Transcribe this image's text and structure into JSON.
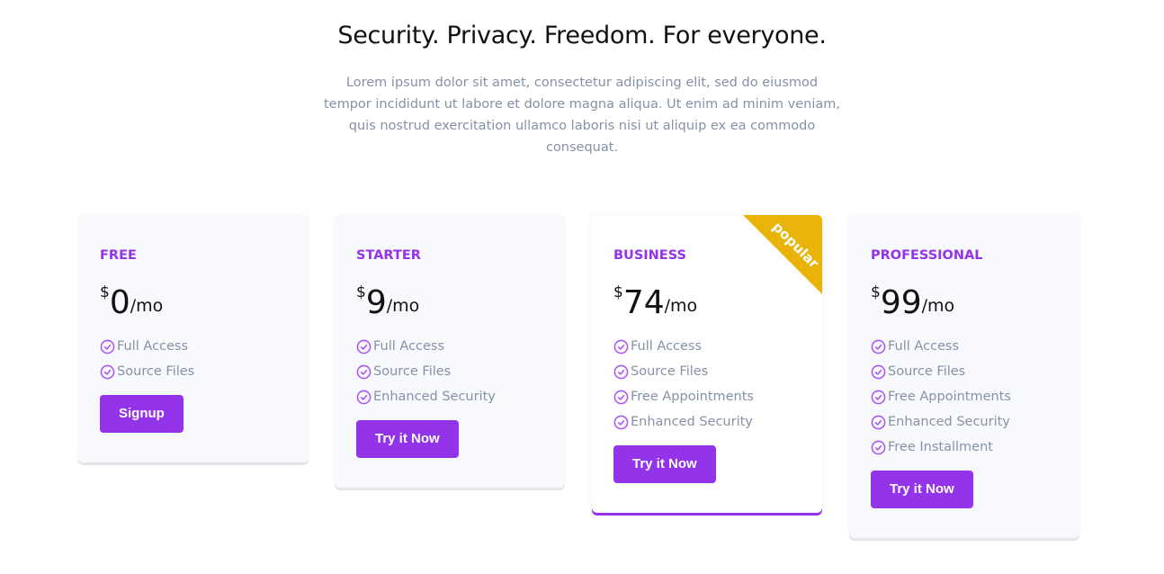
{
  "header": {
    "title": "Security. Privacy. Freedom. For everyone.",
    "description": "Lorem ipsum dolor sit amet, consectetur adipiscing elit, sed do eiusmod tempor incididunt ut labore et dolore magna aliqua. Ut enim ad minim veniam, quis nostrud exercitation ullamco laboris nisi ut aliquip ex ea commodo consequat."
  },
  "colors": {
    "accent": "#9333ea",
    "ribbon": "#eab308",
    "muted": "#8492a6"
  },
  "plans": [
    {
      "name": "FREE",
      "currency": "$",
      "amount": "0",
      "period": "/mo",
      "features": [
        "Full Access",
        "Source Files"
      ],
      "button": "Signup"
    },
    {
      "name": "STARTER",
      "currency": "$",
      "amount": "9",
      "period": "/mo",
      "features": [
        "Full Access",
        "Source Files",
        "Enhanced Security"
      ],
      "button": "Try it Now"
    },
    {
      "name": "BUSINESS",
      "currency": "$",
      "amount": "74",
      "period": "/mo",
      "features": [
        "Full Access",
        "Source Files",
        "Free Appointments",
        "Enhanced Security"
      ],
      "button": "Try it Now",
      "badge": "popular"
    },
    {
      "name": "PROFESSIONAL",
      "currency": "$",
      "amount": "99",
      "period": "/mo",
      "features": [
        "Full Access",
        "Source Files",
        "Free Appointments",
        "Enhanced Security",
        "Free Installment"
      ],
      "button": "Try it Now"
    }
  ]
}
